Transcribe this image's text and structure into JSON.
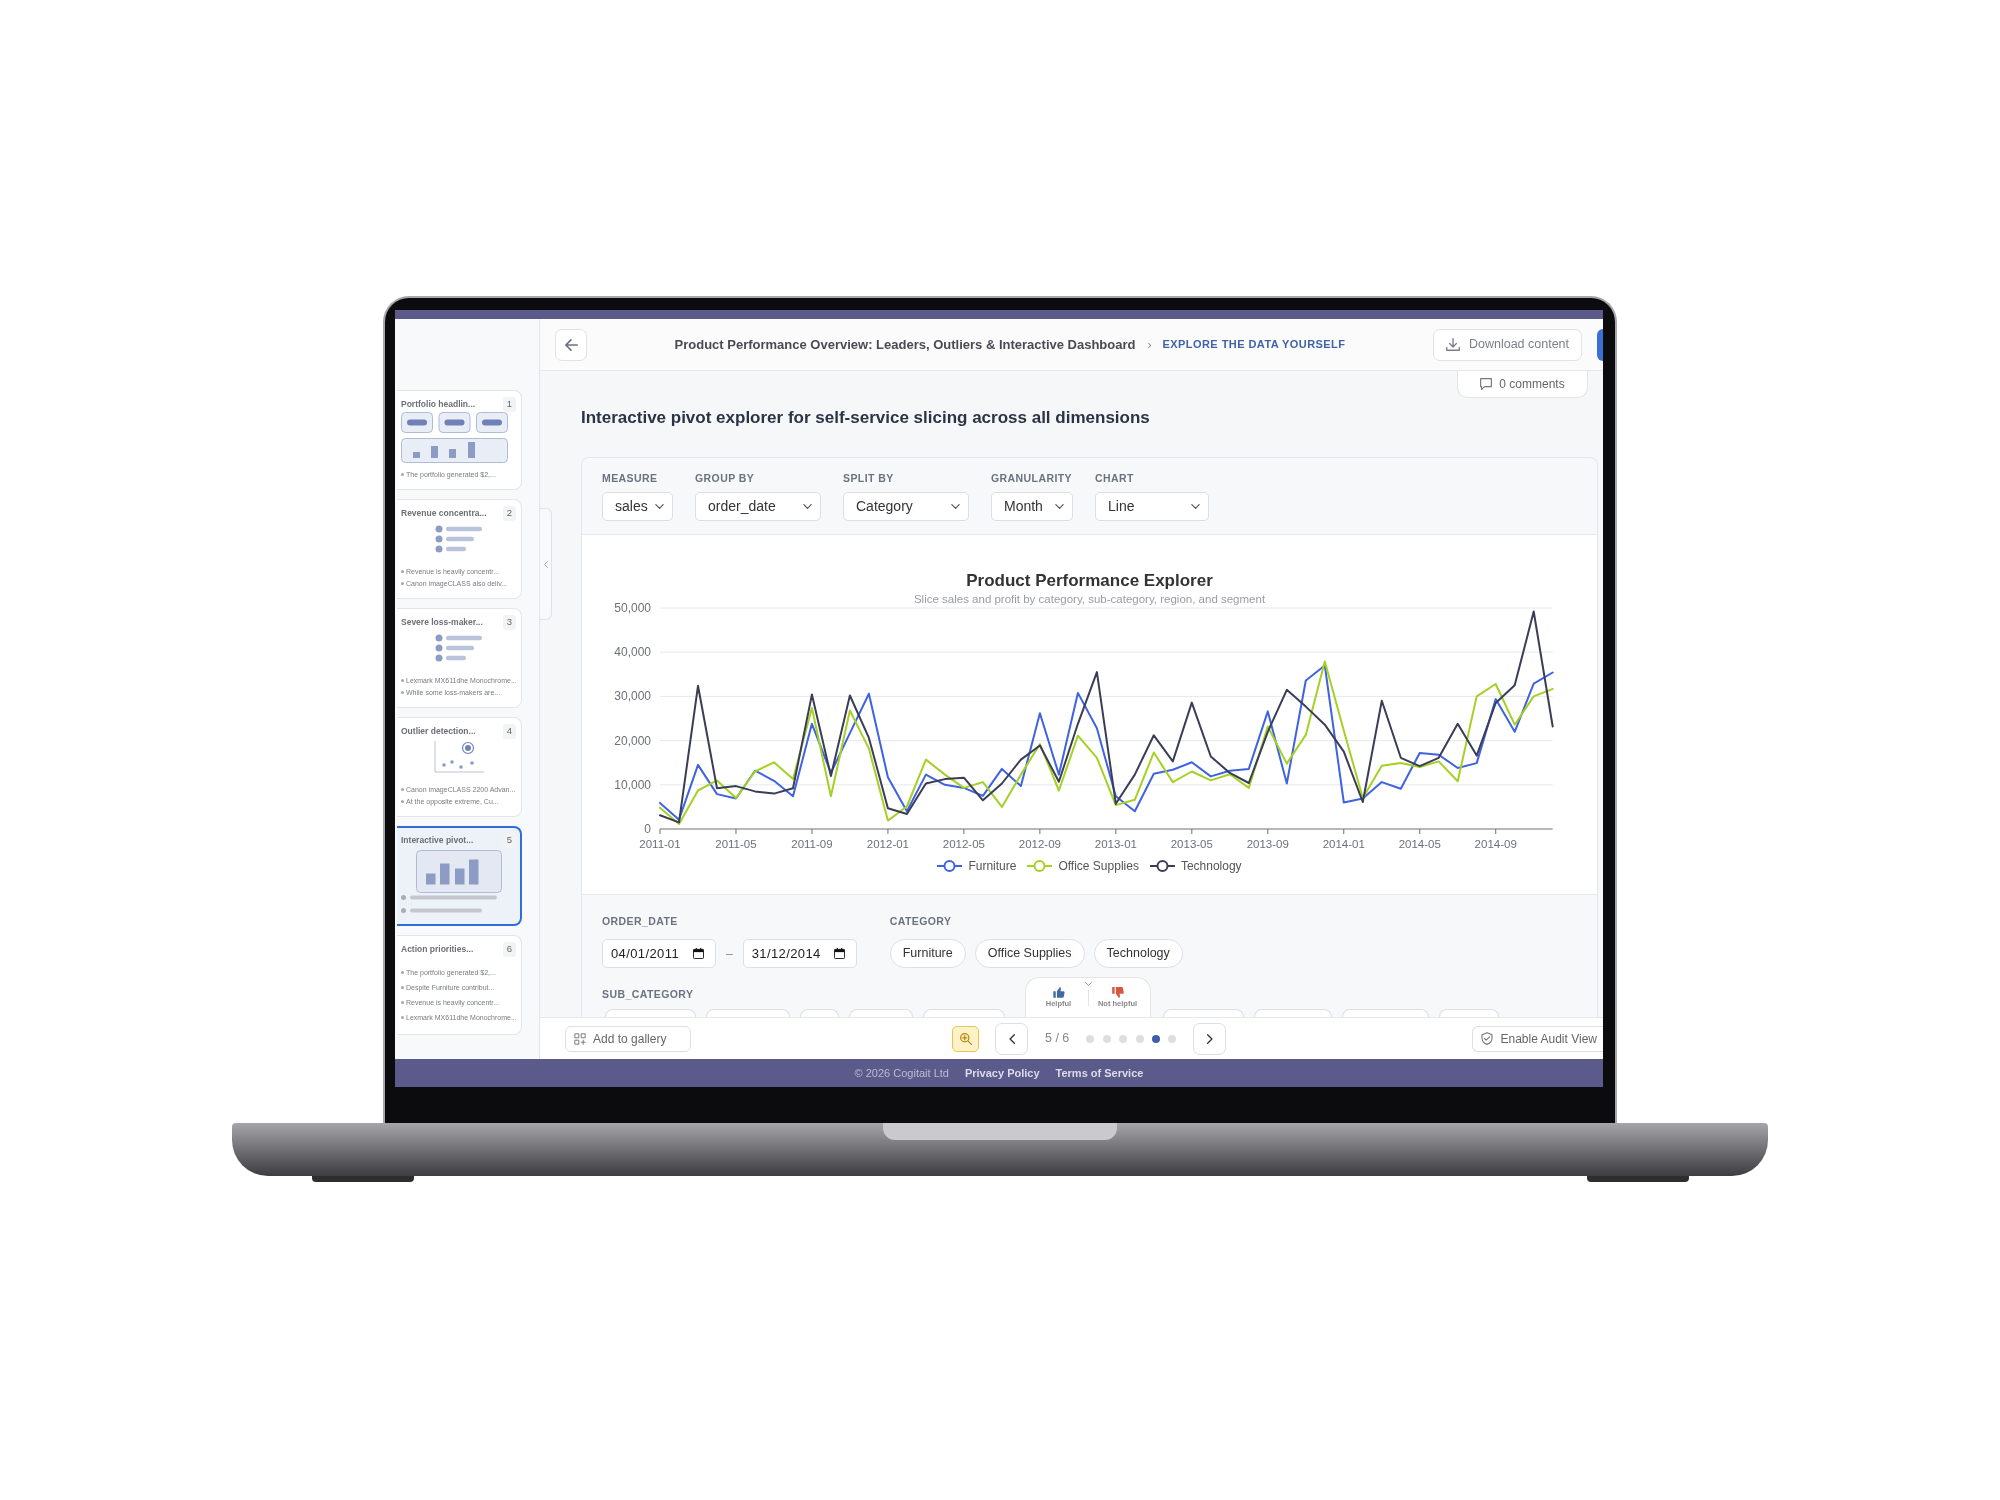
{
  "sidebar": {
    "slides": [
      {
        "number": "1",
        "title": "Portfolio headlin...",
        "kind": "kpi",
        "bullets": [
          "The portfolio generated $2,..."
        ],
        "selected": false
      },
      {
        "number": "2",
        "title": "Revenue concentra...",
        "kind": "list",
        "bullets": [
          "Revenue is heavily concentr...",
          "Canon imageCLASS also deliv..."
        ],
        "selected": false
      },
      {
        "number": "3",
        "title": "Severe loss-maker...",
        "kind": "list",
        "bullets": [
          "Lexmark MX611dhe Monochrome...",
          "While some loss-makers are..."
        ],
        "selected": false
      },
      {
        "number": "4",
        "title": "Outlier detection...",
        "kind": "scatter",
        "bullets": [
          "Canon imageCLASS 2200 Advan...",
          "At the opposite extreme, Cu..."
        ],
        "selected": false
      },
      {
        "number": "5",
        "title": "Interactive pivot...",
        "kind": "bars",
        "selected": true
      },
      {
        "number": "6",
        "title": "Action priorities...",
        "kind": "text",
        "bullets": [
          "The portfolio generated $2,...",
          "Despite Furniture contribut...",
          "Revenue is heavily concentr...",
          "Lexmark MX611dhe Monochrome..."
        ],
        "selected": false
      }
    ]
  },
  "header": {
    "title": "Product Performance Overview: Leaders, Outliers & Interactive Dashboard",
    "separator": "›",
    "section": "EXPLORE THE DATA YOURSELF",
    "download_button": "Download content"
  },
  "comments": "0 comments",
  "heading": "Interactive pivot explorer for self-service slicing across all dimensions",
  "controls": [
    {
      "label": "MEASURE",
      "value": "sales"
    },
    {
      "label": "GROUP BY",
      "value": "order_date"
    },
    {
      "label": "SPLIT BY",
      "value": "Category"
    },
    {
      "label": "GRANULARITY",
      "value": "Month"
    },
    {
      "label": "CHART",
      "value": "Line"
    }
  ],
  "chart": {
    "chart_data": {
      "type": "line",
      "title": "Product Performance Explorer",
      "subtitle": "Slice sales and profit by category, sub-category, region, and segment",
      "categories": [
        "2011-01",
        null,
        null,
        null,
        "2011-05",
        null,
        null,
        null,
        "2011-09",
        null,
        null,
        null,
        "2012-01",
        null,
        null,
        null,
        "2012-05",
        null,
        null,
        null,
        "2012-09",
        null,
        null,
        null,
        "2013-01",
        null,
        null,
        null,
        "2013-05",
        null,
        null,
        null,
        "2013-09",
        null,
        null,
        null,
        "2014-01",
        null,
        null,
        null,
        "2014-05",
        null,
        null,
        null,
        "2014-09",
        null,
        null,
        null
      ],
      "series": [
        {
          "name": "Furniture",
          "color": "#3f63e0",
          "values": [
            5900,
            2100,
            14500,
            7900,
            6900,
            13200,
            10900,
            7400,
            23800,
            12700,
            21700,
            30600,
            11700,
            4000,
            12300,
            10000,
            9300,
            7500,
            13600,
            9700,
            26200,
            12300,
            30800,
            22800,
            7400,
            4000,
            12500,
            13400,
            15100,
            11900,
            13200,
            13600,
            26600,
            10300,
            33600,
            37000,
            6000,
            6900,
            10600,
            9100,
            17200,
            16800,
            13800,
            14900,
            29400,
            22000,
            32900,
            35400
          ]
        },
        {
          "name": "Office Supplies",
          "color": "#a5d024",
          "values": [
            4800,
            1100,
            8700,
            11000,
            7000,
            13000,
            15100,
            11300,
            27400,
            7400,
            26800,
            18200,
            1900,
            5100,
            15700,
            12300,
            9300,
            10600,
            5000,
            12300,
            19200,
            8700,
            21100,
            16100,
            5400,
            6600,
            17300,
            10600,
            13000,
            11000,
            12400,
            9300,
            23200,
            14800,
            21300,
            37900,
            22300,
            7000,
            14300,
            14900,
            14000,
            15300,
            10800,
            30000,
            32800,
            23600,
            30000,
            31700
          ]
        },
        {
          "name": "Technology",
          "color": "#3b3d57",
          "values": [
            3100,
            1500,
            32400,
            9200,
            9700,
            8500,
            8000,
            9200,
            30400,
            12000,
            30200,
            20600,
            4700,
            3400,
            10300,
            11300,
            11600,
            6500,
            10300,
            15700,
            18900,
            10700,
            23800,
            35500,
            5700,
            12300,
            21200,
            15300,
            28600,
            16400,
            12700,
            10400,
            22000,
            31500,
            27700,
            23600,
            17500,
            6100,
            29000,
            16100,
            14200,
            16100,
            23800,
            16600,
            28500,
            32500,
            49200,
            23200
          ]
        }
      ],
      "ylim": [
        0,
        50000
      ],
      "yticks": [
        {
          "value": 0,
          "label": "0"
        },
        {
          "value": 10000,
          "label": "10,000"
        },
        {
          "value": 20000,
          "label": "20,000"
        },
        {
          "value": 30000,
          "label": "30,000"
        },
        {
          "value": 40000,
          "label": "40,000"
        },
        {
          "value": 50000,
          "label": "50,000"
        }
      ],
      "grid": true,
      "legend": "bottom"
    }
  },
  "filters": {
    "order_date": {
      "label": "ORDER_DATE",
      "from": "04/01/2011",
      "separator": "–",
      "to": "31/12/2014"
    },
    "category": {
      "label": "CATEGORY",
      "options": [
        "Furniture",
        "Office Supplies",
        "Technology"
      ]
    },
    "sub_category": {
      "label": "SUB_CATEGORY"
    }
  },
  "feedback": [
    {
      "kind": "helpful",
      "label": "Helpful"
    },
    {
      "kind": "not_helpful",
      "label": "Not helpful"
    }
  ],
  "toolbar": {
    "add_to_gallery": "Add to gallery",
    "page_indicator": "5 / 6",
    "pages": [
      {
        "selected": false
      },
      {
        "selected": false
      },
      {
        "selected": false
      },
      {
        "selected": false
      },
      {
        "selected": true
      },
      {
        "selected": false
      }
    ],
    "audit_button": "Enable Audit View"
  },
  "footer": {
    "copyright": "© 2026 Cogitait Ltd",
    "links": [
      "Privacy Policy",
      "Terms of Service"
    ]
  }
}
